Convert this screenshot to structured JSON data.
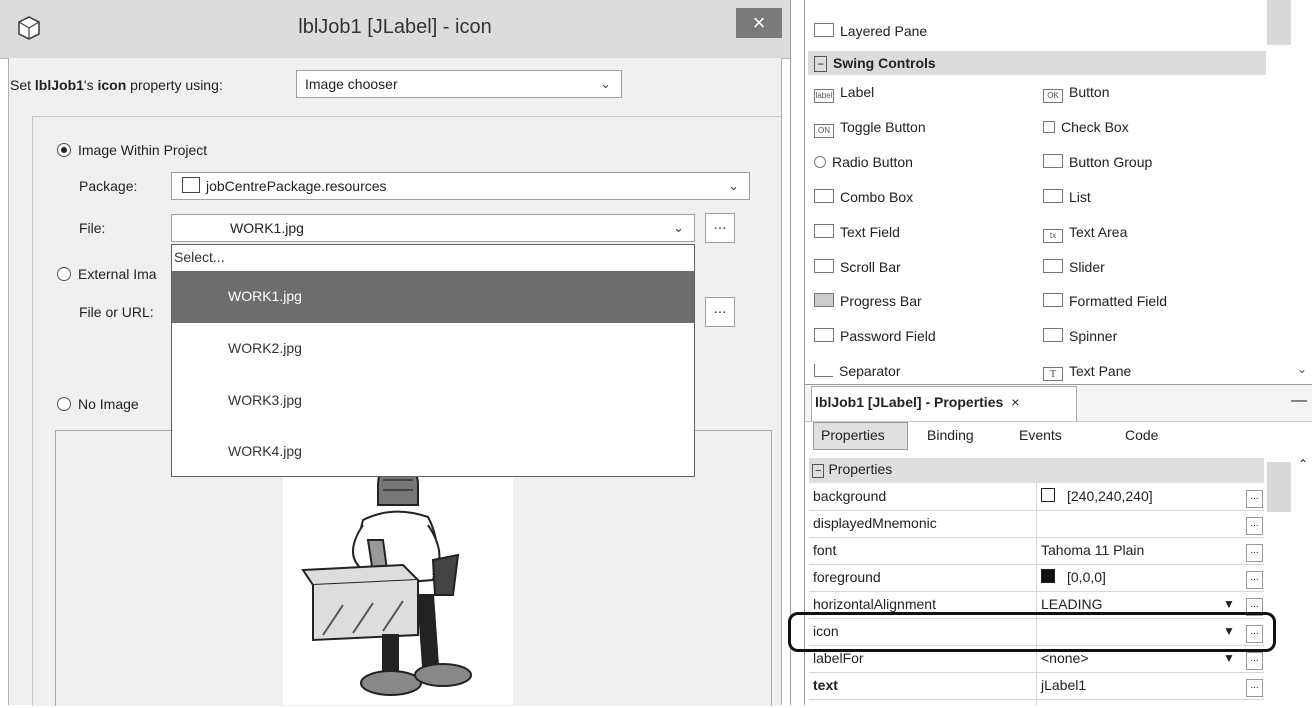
{
  "dialog": {
    "title": "lblJob1 [JLabel] - icon",
    "close_glyph": "×",
    "prop_prefix": "Set ",
    "prop_component": "lblJob1",
    "prop_mid": "'s ",
    "prop_name": "icon",
    "prop_suffix": " property using:",
    "method_value": "Image chooser",
    "radio_project": "Image Within Project",
    "package_label": "Package:",
    "package_value": "jobCentrePackage.resources",
    "file_label": "File:",
    "file_value": "WORK1.jpg",
    "radio_external": "External Ima",
    "url_label": "File or URL:",
    "radio_none": "No Image",
    "ellipsis": "..."
  },
  "dropdown": {
    "items": [
      "Select...",
      "WORK1.jpg",
      "WORK2.jpg",
      "WORK3.jpg",
      "WORK4.jpg"
    ],
    "selected": "WORK1.jpg"
  },
  "palette": {
    "top_item": "Layered Pane",
    "section": "Swing Controls",
    "items": [
      [
        "Label",
        "Button"
      ],
      [
        "Toggle Button",
        "Check Box"
      ],
      [
        "Radio Button",
        "Button Group"
      ],
      [
        "Combo Box",
        "List"
      ],
      [
        "Text Field",
        "Text Area"
      ],
      [
        "Scroll Bar",
        "Slider"
      ],
      [
        "Progress Bar",
        "Formatted Field"
      ],
      [
        "Password Field",
        "Spinner"
      ],
      [
        "Separator",
        "Text Pane"
      ]
    ],
    "icon_labels": [
      "label",
      "OK",
      "ON",
      "tx",
      "T"
    ]
  },
  "properties": {
    "panel_title": "lblJob1 [JLabel] - Properties",
    "tabs": [
      "Properties",
      "Binding",
      "Events",
      "Code"
    ],
    "section": "Properties",
    "rows": [
      {
        "name": "background",
        "value": "[240,240,240]"
      },
      {
        "name": "displayedMnemonic",
        "value": ""
      },
      {
        "name": "font",
        "value": "Tahoma 11 Plain"
      },
      {
        "name": "foreground",
        "value": "[0,0,0]"
      },
      {
        "name": "horizontalAlignment",
        "value": "LEADING"
      },
      {
        "name": "icon",
        "value": ""
      },
      {
        "name": "labelFor",
        "value": "<none>"
      },
      {
        "name": "text",
        "value": "jLabel1"
      }
    ],
    "colors": {
      "background": "#f0f0f0",
      "foreground": "#000000"
    }
  }
}
